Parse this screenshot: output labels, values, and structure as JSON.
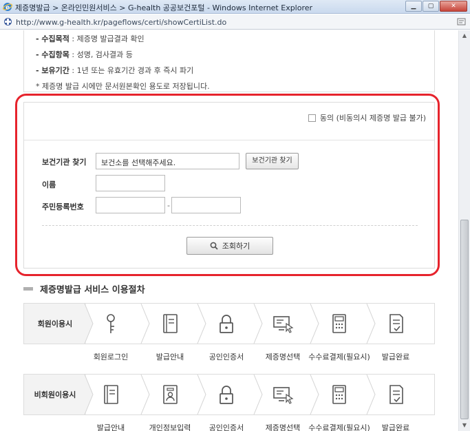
{
  "window": {
    "title": "제증명발급 > 온라인민원서비스 > G-health 공공보건포털 - Windows Internet Explorer",
    "url": "http://www.g-health.kr/pageflows/certi/showCertiList.do"
  },
  "info": {
    "line1_label": "- 수집목적",
    "line1_value": " : 제증명 발급결과 확인",
    "line2_label": "- 수집항목",
    "line2_value": " : 성명, 검사결과 등",
    "line3_label": "- 보유기간",
    "line3_value": " : 1년 또는 유효기간 경과 후 즉시 파기",
    "note": "* 제증명 발급 시에만 문서원본확인 용도로 저장됩니다."
  },
  "form": {
    "agree_label": "동의 (비동의시 제증명 발급 불가)",
    "facility_label": "보건기관 찾기",
    "facility_value": "보건소를 선택해주세요.",
    "facility_button": "보건기관 찾기",
    "name_label": "이름",
    "name_value": "",
    "rrn_label": "주민등록번호",
    "rrn_front": "",
    "rrn_back": "",
    "rrn_separator": "-",
    "search_button": "조회하기"
  },
  "procedure": {
    "title": "제증명발급 서비스 이용절차",
    "member": {
      "label": "회원이용시",
      "steps": [
        "회원로그인",
        "발급안내",
        "공인인증서",
        "제증명선택",
        "수수료결제(필요시)",
        "발급완료"
      ]
    },
    "nonmember": {
      "label": "비회원이용시",
      "steps": [
        "발급안내",
        "개인정보입력",
        "공인인증서",
        "제증명선택",
        "수수료결제(필요시)",
        "발급완료"
      ]
    }
  },
  "icons": {
    "member": [
      "key-icon",
      "book-icon",
      "lock-icon",
      "monitor-cursor-icon",
      "calculator-icon",
      "document-check-icon"
    ],
    "nonmember": [
      "book-icon",
      "id-card-icon",
      "lock-icon",
      "monitor-cursor-icon",
      "calculator-icon",
      "document-check-icon"
    ]
  },
  "colors": {
    "highlight_frame": "#e6232c"
  }
}
